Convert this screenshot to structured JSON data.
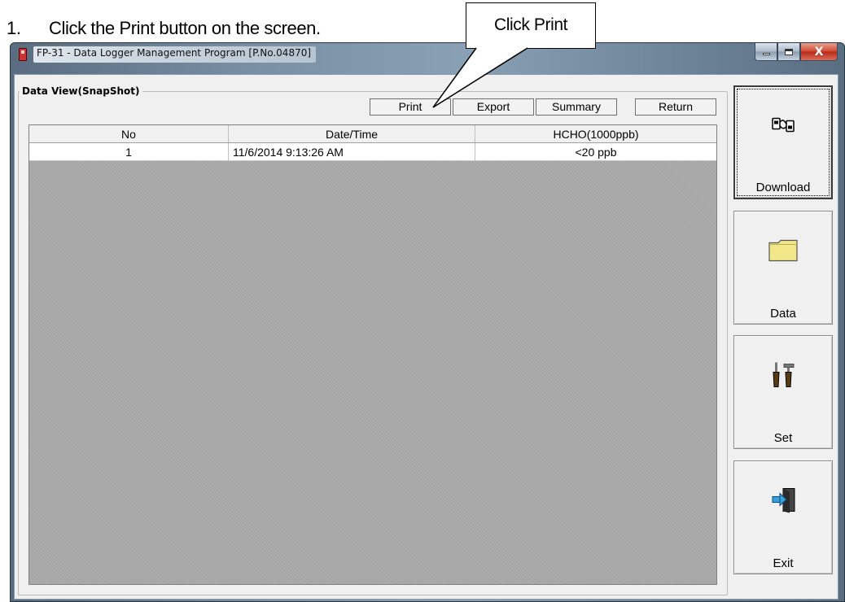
{
  "instruction": {
    "number": "1.",
    "text": "Click the Print button on the screen."
  },
  "callout": {
    "text": "Click Print"
  },
  "window": {
    "title": "FP-31  - Data Logger Management Program [P.No.04870]"
  },
  "caption_buttons": {
    "close": "X"
  },
  "data_view": {
    "title": "Data View(SnapShot)",
    "toolbar": {
      "print": "Print",
      "export": "Export",
      "summary": "Summary",
      "return": "Return"
    },
    "table": {
      "columns": [
        "No",
        "Date/Time",
        "HCHO(1000ppb)"
      ],
      "rows": [
        {
          "no": "1",
          "datetime": "11/6/2014 9:13:26 AM",
          "hcho": "<20  ppb"
        }
      ]
    }
  },
  "side_menu": [
    {
      "label": "Download",
      "icon": "download-cable-icon",
      "focused": true
    },
    {
      "label": "Data",
      "icon": "folder-icon",
      "focused": false
    },
    {
      "label": "Set",
      "icon": "tools-icon",
      "focused": false
    },
    {
      "label": "Exit",
      "icon": "exit-door-icon",
      "focused": false
    }
  ],
  "colors": {
    "grid_background": "#a6a6a6",
    "close_button": "#c8402a",
    "folder": "#f0e68c"
  }
}
